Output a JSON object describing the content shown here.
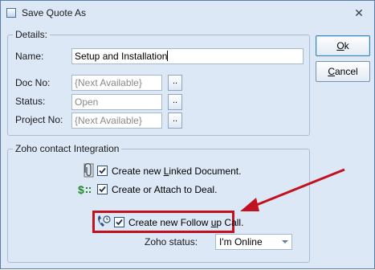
{
  "window": {
    "title": "Save Quote As",
    "close_glyph": "✕"
  },
  "details": {
    "legend": "Details:",
    "name_label": "Name:",
    "name_value": "Setup and Installation",
    "docno_label": "Doc No:",
    "docno_value": "{Next Available}",
    "status_label": "Status:",
    "status_value": "Open",
    "project_label": "Project No:",
    "project_value": "{Next Available}",
    "ellipsis_label": ".."
  },
  "zoho": {
    "legend": "Zoho contact Integration",
    "linked_doc_pre": "Create new ",
    "linked_doc_u": "L",
    "linked_doc_post": "inked Document.",
    "linked_doc_checked": true,
    "deal_pre": "Create or Attach to Deal.",
    "deal_checked": true,
    "followup_pre": "Create new Follow ",
    "followup_u": "u",
    "followup_post": "p Call.",
    "followup_checked": true,
    "status_label": "Zoho status:",
    "status_value": "I'm Online"
  },
  "buttons": {
    "ok_u": "O",
    "ok_rest": "k",
    "cancel_u": "C",
    "cancel_rest": "ancel"
  },
  "icons": {
    "paperclip": "paperclip-icon",
    "deal": "dollar-deal-icon",
    "followup": "phone-clock-icon"
  },
  "colors": {
    "dialog_bg": "#dce8f5",
    "highlight": "#c1121f",
    "deal_icon": "#1f8a2a"
  }
}
